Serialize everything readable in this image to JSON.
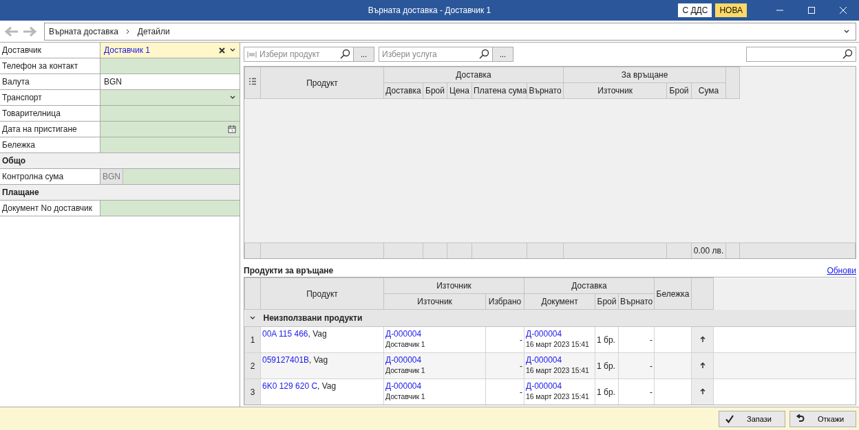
{
  "window": {
    "title": "Върната доставка - Доставчик 1",
    "badges": [
      {
        "label": "С ДДС",
        "kind": "vat"
      },
      {
        "label": "НОВА",
        "kind": "status"
      }
    ]
  },
  "breadcrumb": [
    "Върната доставка",
    "Детайли"
  ],
  "form": [
    {
      "kind": "combo",
      "label": "Доставчик",
      "value": "Доставчик 1"
    },
    {
      "kind": "text",
      "label": "Телефон за контакт"
    },
    {
      "kind": "readonly",
      "label": "Валута",
      "value": "BGN"
    },
    {
      "kind": "dropdown",
      "label": "Транспорт"
    },
    {
      "kind": "text",
      "label": "Товарителница"
    },
    {
      "kind": "date",
      "label": "Дата на пристигане"
    },
    {
      "kind": "text",
      "label": "Бележка"
    },
    {
      "kind": "section",
      "label": "Общо"
    },
    {
      "kind": "currency",
      "label": "Контролна сума",
      "prefix": "BGN"
    },
    {
      "kind": "section",
      "label": "Плащане"
    },
    {
      "kind": "text",
      "label": "Документ No доставчик"
    }
  ],
  "product_search": {
    "placeholder": "Избери продукт",
    "button": "..."
  },
  "service_search": {
    "placeholder": "Избери услуга",
    "button": "..."
  },
  "items_table": {
    "product_header": "Продукт",
    "groups": [
      {
        "label": "Доставка",
        "columns": [
          "Доставка",
          "Брой",
          "Цена",
          "Платена сума",
          "Върнато"
        ]
      },
      {
        "label": "За връщане",
        "columns": [
          "Източник",
          "Брой",
          "Сума"
        ]
      }
    ],
    "total": "0.00 лв."
  },
  "return_section": {
    "title": "Продукти за връщане",
    "refresh_link": "Обнови"
  },
  "return_table": {
    "product_header": "Продукт",
    "groups": [
      {
        "label": "Източник",
        "columns": [
          "Източник",
          "Избрано"
        ]
      },
      {
        "label": "Доставка",
        "columns": [
          "Документ",
          "Брой",
          "Върнато"
        ]
      }
    ],
    "note_header": "Бележка",
    "row_groups": [
      {
        "label": "Неизползвани продукти",
        "expanded": true,
        "rows": [
          {
            "number": "1",
            "code": "00A 115 466",
            "suffix": ", Vag",
            "source_doc": "Д-000004",
            "source_name": "Доставчик 1",
            "selected": "-",
            "doc": "Д-000004",
            "date": "16 март 2023 15:41",
            "qty": "1 бр.",
            "returned": "-"
          },
          {
            "number": "2",
            "code": "059127401B",
            "suffix": ", Vag",
            "source_doc": "Д-000004",
            "source_name": "Доставчик 1",
            "selected": "-",
            "doc": "Д-000004",
            "date": "16 март 2023 15:41",
            "qty": "1 бр.",
            "returned": "-"
          },
          {
            "number": "3",
            "code": "6K0 129 620 C",
            "suffix": ", Vag",
            "source_doc": "Д-000004",
            "source_name": "Доставчик 1",
            "selected": "-",
            "doc": "Д-000004",
            "date": "16 март 2023 15:41",
            "qty": "1 бр.",
            "returned": "-"
          }
        ]
      }
    ]
  },
  "footer_buttons": [
    {
      "label": "Запази",
      "kind": "save"
    },
    {
      "label": "Откажи",
      "kind": "cancel"
    }
  ]
}
